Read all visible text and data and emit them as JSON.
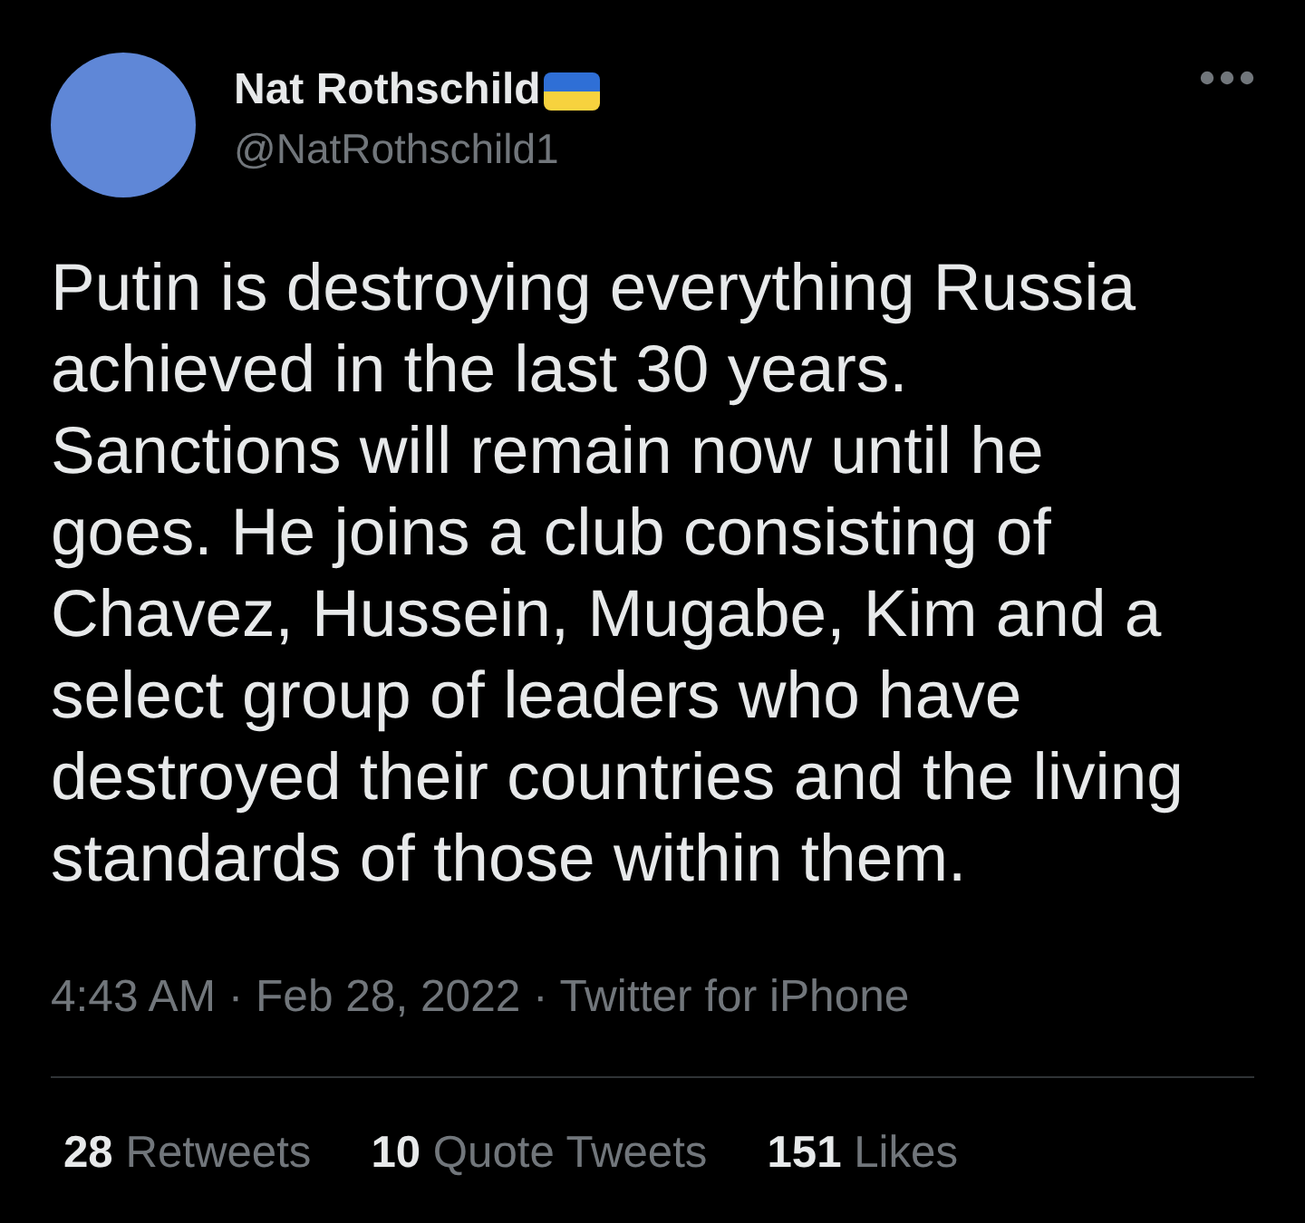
{
  "author": {
    "name": "Nat Rothschild",
    "handle": "@NatRothschild1"
  },
  "tweet": {
    "text": "Putin is destroying everything Russia achieved in the last 30 years.\nSanctions will remain now until he goes. He joins a club consisting of Chavez, Hussein, Mugabe, Kim and a select group of leaders who have destroyed their countries and the living standards of those within them.",
    "meta": "4:43 AM · Feb 28, 2022 · Twitter for iPhone"
  },
  "stats": [
    {
      "count": "28",
      "label": "Retweets"
    },
    {
      "count": "10",
      "label": "Quote Tweets"
    },
    {
      "count": "151",
      "label": "Likes"
    }
  ]
}
